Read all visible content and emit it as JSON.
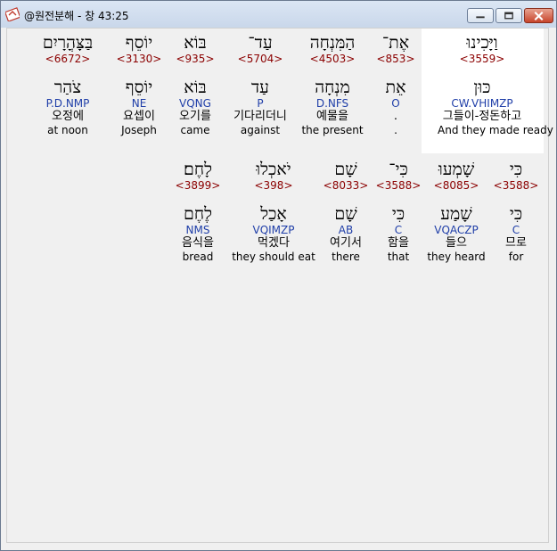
{
  "window": {
    "title": "@원전분해 - 창 43:25"
  },
  "rows": [
    [
      {
        "heb": "וַיָּכִינוּ",
        "strong": "<3559>",
        "lemma": "כּוּן",
        "morph": "CW.VHIMZP",
        "kor": "그들이-정돈하고",
        "eng": "And they made ready"
      },
      {
        "heb": "אֶת־",
        "strong": "<853>",
        "lemma": "אֵת",
        "morph": "O",
        "kor": ".",
        "eng": "."
      },
      {
        "heb": "הַמִּנְחָה",
        "strong": "<4503>",
        "lemma": "מִנְחָה",
        "morph": "D.NFS",
        "kor": "예물을",
        "eng": "the present"
      },
      {
        "heb": "עַד־",
        "strong": "<5704>",
        "lemma": "עַד",
        "morph": "P",
        "kor": "기다리더니",
        "eng": "against"
      },
      {
        "heb": "בּוֹא",
        "strong": "<935>",
        "lemma": "בּוֹא",
        "morph": "VQNG",
        "kor": "오기를",
        "eng": "came"
      },
      {
        "heb": "יוֹסֵף",
        "strong": "<3130>",
        "lemma": "יוֹסֵף",
        "morph": "NE",
        "kor": "요셉이",
        "eng": "Joseph"
      },
      {
        "heb": "בַּצָּהֳרָיִם",
        "strong": "<6672>",
        "lemma": "צֹהַר",
        "morph": "P.D.NMP",
        "kor": "오정에",
        "eng": "at noon"
      }
    ],
    [
      {
        "heb": "כִּי",
        "strong": "<3588>",
        "lemma": "כִּי",
        "morph": "C",
        "kor": "므로",
        "eng": "for"
      },
      {
        "heb": "שָׁמְעוּ",
        "strong": "<8085>",
        "lemma": "שָׁמַע",
        "morph": "VQACZP",
        "kor": "들으",
        "eng": "they heard"
      },
      {
        "heb": "כִּי־",
        "strong": "<3588>",
        "lemma": "כִּי",
        "morph": "C",
        "kor": "함을",
        "eng": "that"
      },
      {
        "heb": "שָׁם",
        "strong": "<8033>",
        "lemma": "שָׁם",
        "morph": "AB",
        "kor": "여기서",
        "eng": "there"
      },
      {
        "heb": "יֹאכְלוּ",
        "strong": "<398>",
        "lemma": "אָכַל",
        "morph": "VQIMZP",
        "kor": "먹겠다",
        "eng": "they should eat"
      },
      {
        "heb": "לָחֶם׃",
        "strong": "<3899>",
        "lemma": "לֶחֶם",
        "morph": "NMS",
        "kor": "음식을",
        "eng": "bread"
      }
    ]
  ]
}
